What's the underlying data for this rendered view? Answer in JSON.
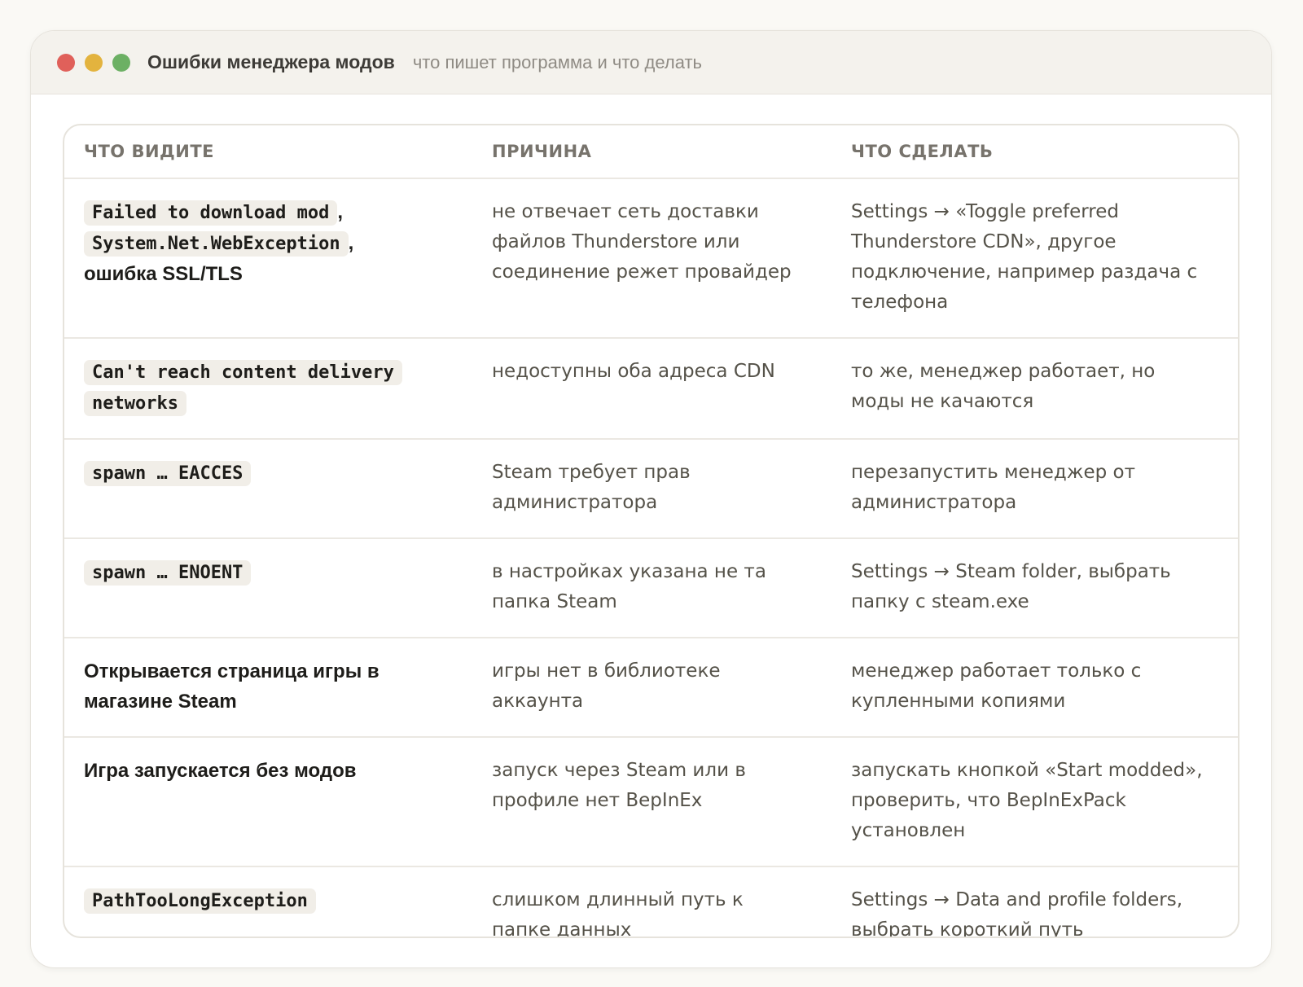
{
  "window": {
    "title": "Ошибки менеджера модов",
    "subtitle": "что пишет программа и что делать"
  },
  "table": {
    "headers": [
      "ЧТО ВИДИТЕ",
      "ПРИЧИНА",
      "ЧТО СДЕЛАТЬ"
    ],
    "rows": [
      {
        "see_code_1": "Failed to download mod",
        "see_sep_1": ",",
        "see_code_2": "System.Net.WebException",
        "see_sep_2": ",",
        "see_text": "ошибка SSL/TLS",
        "cause": "не отвечает сеть доставки файлов Thunderstore или соединение режет провайдер",
        "fix": "Settings → «Toggle preferred Thunderstore CDN», другое подключение, например раздача с телефона"
      },
      {
        "see_code": "Can't reach content delivery networks",
        "cause": "недоступны оба адреса CDN",
        "fix": "то же, менеджер работает, но моды не качаются"
      },
      {
        "see_code": "spawn … EACCES",
        "cause": "Steam требует прав администратора",
        "fix": "перезапустить менеджер от администратора"
      },
      {
        "see_code": "spawn … ENOENT",
        "cause": "в настройках указана не та папка Steam",
        "fix": "Settings → Steam folder, выбрать папку с steam.exe"
      },
      {
        "see_text": "Открывается страница игры в магазине Steam",
        "cause": "игры нет в библиотеке аккаунта",
        "fix": "менеджер работает только с купленными копиями"
      },
      {
        "see_text": "Игра запускается без модов",
        "cause": "запуск через Steam или в профиле нет BepInEx",
        "fix": "запускать кнопкой «Start modded», проверить, что BepInExPack установлен"
      },
      {
        "see_code": "PathTooLongException",
        "cause": "слишком длинный путь к папке данных",
        "fix": "Settings → Data and profile folders, выбрать короткий путь"
      }
    ]
  }
}
